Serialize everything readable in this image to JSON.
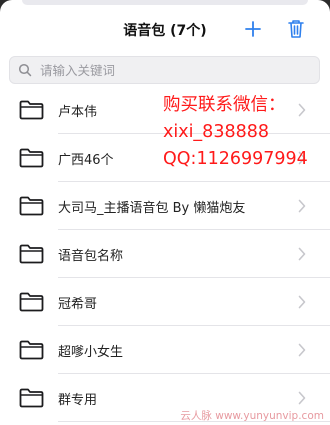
{
  "header": {
    "title": "语音包 (7个)",
    "add_icon": "plus-icon",
    "delete_icon": "trash-icon"
  },
  "search": {
    "placeholder": "请输入关键词",
    "value": ""
  },
  "list": {
    "items": [
      {
        "label": "卢本伟"
      },
      {
        "label": "广西46个"
      },
      {
        "label": "大司马_主播语音包 By 懒猫炮友"
      },
      {
        "label": "语音包名称"
      },
      {
        "label": "冠希哥"
      },
      {
        "label": "超嗲小女生"
      },
      {
        "label": "群专用"
      }
    ]
  },
  "overlay": {
    "line1": "购买联系微信：",
    "line2": "xixi_838888",
    "line3": "QQ:1126997994"
  },
  "watermark": {
    "text": "云人脉 www.yunyunvip.com"
  },
  "colors": {
    "accent": "#2f80ed",
    "overlay_text": "#ff1a1a",
    "divider": "#e4e4e8"
  }
}
